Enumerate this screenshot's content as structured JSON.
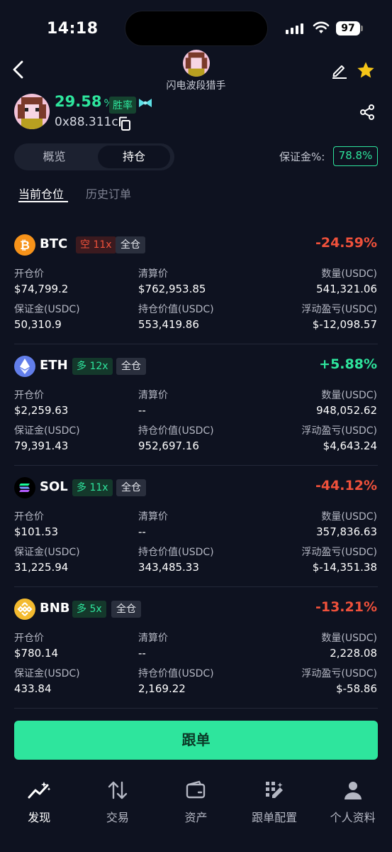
{
  "status_bar": {
    "time": "14:18",
    "battery": "97"
  },
  "header": {
    "trader_name": "闪电波段猎手",
    "back_icon": "chevron-left-icon",
    "edit_icon": "edit-icon",
    "favorite_icon": "star-icon"
  },
  "profile": {
    "win_rate": "29.58",
    "win_rate_unit": "%",
    "win_rate_label": "胜率",
    "address": "0x88.311c"
  },
  "tabs": {
    "overview": "概览",
    "positions": "持仓"
  },
  "margin": {
    "label": "保证金%:",
    "value": "78.8%"
  },
  "subtabs": {
    "current": "当前仓位",
    "history": "历史订单"
  },
  "labels": {
    "entry": "开仓价",
    "liq": "清算价",
    "qty": "数量(USDC)",
    "margin": "保证金(USDC)",
    "value": "持仓价值(USDC)",
    "pnl": "浮动盈亏(USDC)"
  },
  "positions": [
    {
      "symbol": "BTC",
      "side": "空 11x",
      "mode": "全仓",
      "pnl_pct": "-24.59%",
      "entry": "$74,799.2",
      "liq": "$762,953.85",
      "qty": "541,321.06",
      "margin": "50,310.9",
      "value": "553,419.86",
      "pnl": "$-12,098.57"
    },
    {
      "symbol": "ETH",
      "side": "多 12x",
      "mode": "全仓",
      "pnl_pct": "+5.88%",
      "entry": "$2,259.63",
      "liq": "--",
      "qty": "948,052.62",
      "margin": "79,391.43",
      "value": "952,697.16",
      "pnl": "$4,643.24"
    },
    {
      "symbol": "SOL",
      "side": "多 11x",
      "mode": "全仓",
      "pnl_pct": "-44.12%",
      "entry": "$101.53",
      "liq": "--",
      "qty": "357,836.63",
      "margin": "31,225.94",
      "value": "343,485.33",
      "pnl": "$-14,351.38"
    },
    {
      "symbol": "BNB",
      "side": "多 5x",
      "mode": "全仓",
      "pnl_pct": "-13.21%",
      "entry": "$780.14",
      "liq": "--",
      "qty": "2,228.08",
      "margin": "433.84",
      "value": "2,169.22",
      "pnl": "$-58.86"
    }
  ],
  "follow_button": "跟单",
  "nav": {
    "discover": "发现",
    "trade": "交易",
    "assets": "资产",
    "copy_settings": "跟单配置",
    "profile": "个人资料"
  },
  "colors": {
    "bg": "#0e1220",
    "green": "#2ee59d",
    "red": "#f0513b",
    "btc": "#f7931a",
    "eth": "#627eea",
    "bnb": "#f3ba2f"
  }
}
